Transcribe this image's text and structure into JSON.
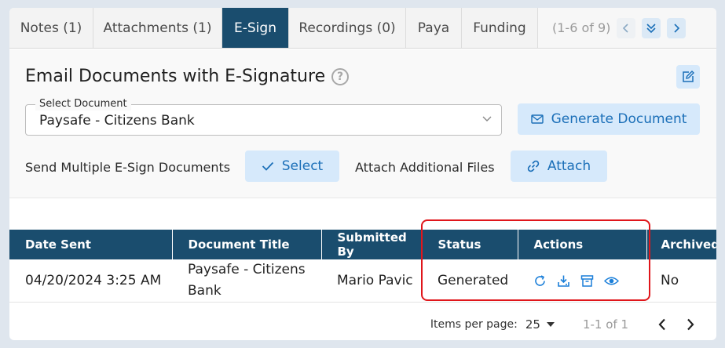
{
  "tabs": [
    {
      "label": "Notes (1)",
      "active": false
    },
    {
      "label": "Attachments (1)",
      "active": false
    },
    {
      "label": "E-Sign",
      "active": true
    },
    {
      "label": "Recordings (0)",
      "active": false
    },
    {
      "label": "Paya",
      "active": false
    },
    {
      "label": "Funding",
      "active": false
    }
  ],
  "tab_pager": {
    "range": "(1-6 of 9)"
  },
  "esign": {
    "title": "Email Documents with E-Signature",
    "select_label": "Select Document",
    "select_value": "Paysafe - Citizens Bank",
    "generate_label": "Generate Document",
    "multi_label": "Send Multiple E-Sign Documents",
    "select_button": "Select",
    "attach_label": "Attach Additional Files",
    "attach_button": "Attach"
  },
  "table": {
    "headers": [
      "Date Sent",
      "Document Title",
      "Submitted By",
      "Status",
      "Actions",
      "Archived"
    ],
    "rows": [
      {
        "date_sent": "04/20/2024 3:25 AM",
        "document_title": "Paysafe - Citizens Bank",
        "submitted_by": "Mario Pavic",
        "status": "Generated",
        "actions": [
          "refresh-icon",
          "download-icon",
          "archive-icon",
          "view-icon"
        ],
        "archived": "No"
      }
    ]
  },
  "paginator": {
    "items_per_page_label": "Items per page:",
    "items_per_page_value": "25",
    "range": "1-1 of 1"
  },
  "colors": {
    "header_bg": "#1a4d6e",
    "button_bg": "#d6e9fb",
    "button_text": "#1b6fb8",
    "highlight": "#e0161b"
  }
}
